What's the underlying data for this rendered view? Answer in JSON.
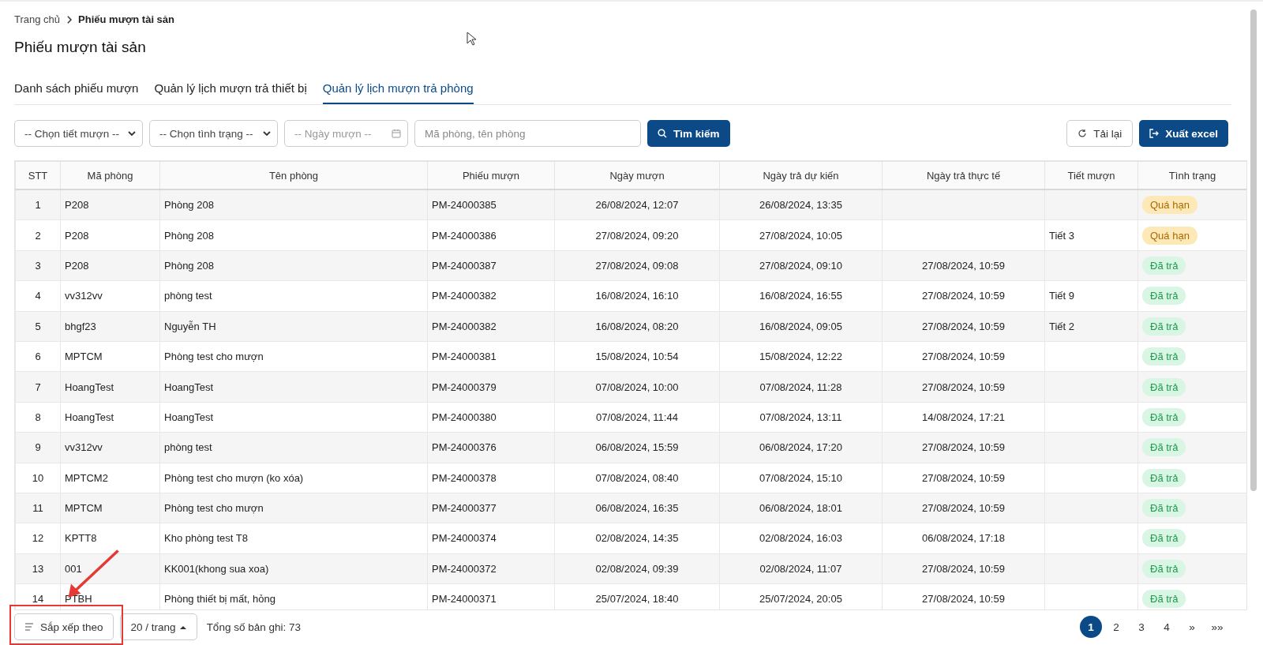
{
  "breadcrumb": [
    {
      "label": "Trang chủ"
    },
    {
      "label": "Phiếu mượn tài sản"
    }
  ],
  "title": "Phiếu mượn tài sản",
  "tabs": [
    {
      "label": "Danh sách phiếu mượn",
      "selected": false
    },
    {
      "label": "Quản lý lịch mượn trả thiết bị",
      "selected": false
    },
    {
      "label": "Quản lý lịch mượn trả phòng",
      "selected": true
    }
  ],
  "filters": {
    "period": {
      "placeholder": "-- Chọn tiết mượn --"
    },
    "status": {
      "placeholder": "-- Chọn tình trạng --"
    },
    "date": {
      "placeholder": "-- Ngày mượn --"
    },
    "search": {
      "placeholder": "Mã phòng, tên phòng"
    },
    "search_button": "Tìm kiếm",
    "reload_button": "Tải lại",
    "export_button": "Xuất excel"
  },
  "table": {
    "columns": [
      "STT",
      "Mã phòng",
      "Tên phòng",
      "Phiếu mượn",
      "Ngày mượn",
      "Ngày trả dự kiến",
      "Ngày trả thực tế",
      "Tiết mượn",
      "Tình trạng"
    ],
    "rows": [
      {
        "no": "1",
        "code": "P208",
        "name": "Phòng 208",
        "ticket": "PM-24000385",
        "borrowed": "26/08/2024, 12:07",
        "due": "26/08/2024, 13:35",
        "returned": "",
        "period": "",
        "status": "Quá hạn",
        "kind": "overdue"
      },
      {
        "no": "2",
        "code": "P208",
        "name": "Phòng 208",
        "ticket": "PM-24000386",
        "borrowed": "27/08/2024, 09:20",
        "due": "27/08/2024, 10:05",
        "returned": "",
        "period": "Tiết 3",
        "status": "Quá hạn",
        "kind": "overdue"
      },
      {
        "no": "3",
        "code": "P208",
        "name": "Phòng 208",
        "ticket": "PM-24000387",
        "borrowed": "27/08/2024, 09:08",
        "due": "27/08/2024, 09:10",
        "returned": "27/08/2024, 10:59",
        "period": "",
        "status": "Đã trả",
        "kind": "returned"
      },
      {
        "no": "4",
        "code": "vv312vv",
        "name": "phòng test",
        "ticket": "PM-24000382",
        "borrowed": "16/08/2024, 16:10",
        "due": "16/08/2024, 16:55",
        "returned": "27/08/2024, 10:59",
        "period": "Tiết 9",
        "status": "Đã trả",
        "kind": "returned"
      },
      {
        "no": "5",
        "code": "bhgf23",
        "name": "Nguyễn TH",
        "ticket": "PM-24000382",
        "borrowed": "16/08/2024, 08:20",
        "due": "16/08/2024, 09:05",
        "returned": "27/08/2024, 10:59",
        "period": "Tiết 2",
        "status": "Đã trả",
        "kind": "returned"
      },
      {
        "no": "6",
        "code": "MPTCM",
        "name": "Phòng test cho mượn",
        "ticket": "PM-24000381",
        "borrowed": "15/08/2024, 10:54",
        "due": "15/08/2024, 12:22",
        "returned": "27/08/2024, 10:59",
        "period": "",
        "status": "Đã trả",
        "kind": "returned"
      },
      {
        "no": "7",
        "code": "HoangTest",
        "name": "HoangTest",
        "ticket": "PM-24000379",
        "borrowed": "07/08/2024, 10:00",
        "due": "07/08/2024, 11:28",
        "returned": "27/08/2024, 10:59",
        "period": "",
        "status": "Đã trả",
        "kind": "returned"
      },
      {
        "no": "8",
        "code": "HoangTest",
        "name": "HoangTest",
        "ticket": "PM-24000380",
        "borrowed": "07/08/2024, 11:44",
        "due": "07/08/2024, 13:11",
        "returned": "14/08/2024, 17:21",
        "period": "",
        "status": "Đã trả",
        "kind": "returned"
      },
      {
        "no": "9",
        "code": "vv312vv",
        "name": "phòng test",
        "ticket": "PM-24000376",
        "borrowed": "06/08/2024, 15:59",
        "due": "06/08/2024, 17:20",
        "returned": "27/08/2024, 10:59",
        "period": "",
        "status": "Đã trả",
        "kind": "returned"
      },
      {
        "no": "10",
        "code": "MPTCM2",
        "name": "Phòng test cho mượn (ko xóa)",
        "ticket": "PM-24000378",
        "borrowed": "07/08/2024, 08:40",
        "due": "07/08/2024, 15:10",
        "returned": "27/08/2024, 10:59",
        "period": "",
        "status": "Đã trả",
        "kind": "returned"
      },
      {
        "no": "11",
        "code": "MPTCM",
        "name": "Phòng test cho mượn",
        "ticket": "PM-24000377",
        "borrowed": "06/08/2024, 16:35",
        "due": "06/08/2024, 18:01",
        "returned": "27/08/2024, 10:59",
        "period": "",
        "status": "Đã trả",
        "kind": "returned"
      },
      {
        "no": "12",
        "code": "KPTT8",
        "name": "Kho phòng test T8",
        "ticket": "PM-24000374",
        "borrowed": "02/08/2024, 14:35",
        "due": "02/08/2024, 16:03",
        "returned": "06/08/2024, 17:18",
        "period": "",
        "status": "Đã trả",
        "kind": "returned"
      },
      {
        "no": "13",
        "code": "001",
        "name": "KK001(khong sua xoa)",
        "ticket": "PM-24000372",
        "borrowed": "02/08/2024, 09:39",
        "due": "02/08/2024, 11:07",
        "returned": "27/08/2024, 10:59",
        "period": "",
        "status": "Đã trả",
        "kind": "returned"
      },
      {
        "no": "14",
        "code": "PTBH",
        "name": "Phòng thiết bị mất, hỏng",
        "ticket": "PM-24000371",
        "borrowed": "25/07/2024, 18:40",
        "due": "25/07/2024, 20:05",
        "returned": "27/08/2024, 10:59",
        "period": "",
        "status": "Đã trả",
        "kind": "returned"
      }
    ]
  },
  "footer": {
    "sort_button": "Sắp xếp theo",
    "page_size": "20 / trang",
    "total": "Tổng số bản ghi: 73",
    "pages": [
      {
        "label": "1",
        "selected": true
      },
      {
        "label": "2",
        "selected": false
      },
      {
        "label": "3",
        "selected": false
      },
      {
        "label": "4",
        "selected": false
      }
    ],
    "next": "»",
    "last": "»»"
  }
}
